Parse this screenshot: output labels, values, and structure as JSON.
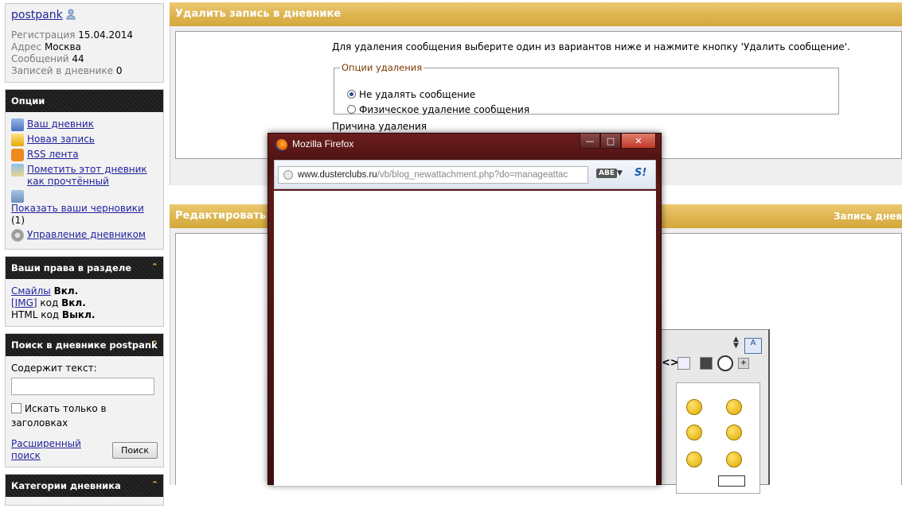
{
  "profile": {
    "username": "postpank",
    "registration_label": "Регистрация",
    "registration_value": "15.04.2014",
    "address_label": "Адрес",
    "address_value": "Москва",
    "messages_label": "Сообщений",
    "messages_value": "44",
    "entries_label": "Записей в дневнике",
    "entries_value": "0"
  },
  "options": {
    "title": "Опции",
    "items": [
      {
        "label": "Ваш дневник",
        "icon": "blog-icon"
      },
      {
        "label": "Новая запись",
        "icon": "pencil-icon"
      },
      {
        "label": "RSS лента",
        "icon": "rss-icon"
      },
      {
        "label": "Пометить этот дневник как прочтённый",
        "icon": "mark-read-icon"
      },
      {
        "label": "Показать ваши черновики",
        "icon": "drafts-icon",
        "suffix": "(1)"
      },
      {
        "label": "Управление дневником",
        "icon": "gear-icon"
      }
    ]
  },
  "permissions": {
    "title": "Ваши права в разделе",
    "smilies_label": "Смайлы",
    "smilies_value": "Вкл.",
    "img_label": "[IMG]",
    "img_suffix": "код",
    "img_value": "Вкл.",
    "html_label": "HTML код",
    "html_value": "Выкл."
  },
  "search": {
    "title": "Поиск в дневнике postpank",
    "contains_label": "Содержит текст:",
    "input_value": "",
    "titles_only_label": "Искать только в заголовках",
    "advanced_link": "Расширенный поиск",
    "search_button": "Поиск"
  },
  "categories": {
    "title": "Категории дневника"
  },
  "delete_section": {
    "title": "Удалить запись в дневнике",
    "instruction": "Для удаления сообщения выберите один из вариантов ниже и нажмите кнопку 'Удалить сообщение'.",
    "options_legend": "Опции удаления",
    "option_keep": "Не удалять сообщение",
    "option_physical": "Физическое удаление сообщения",
    "selected": "keep",
    "reason_label": "Причина удаления"
  },
  "edit_section": {
    "title": "Редактировать",
    "right_label": "Запись днев"
  },
  "popup": {
    "window_title": "Mozilla Firefox",
    "url_host": "www.dusterclubs.ru",
    "url_path": "/vb/blog_newattachment.php?do=manageattac",
    "addon_label": "ABE",
    "si_label": "S!"
  },
  "colors": {
    "section_header": "#ddb44f",
    "sidebar_header": "#1e1e1e",
    "link": "#22229c",
    "popup_frame": "#4b1212"
  }
}
